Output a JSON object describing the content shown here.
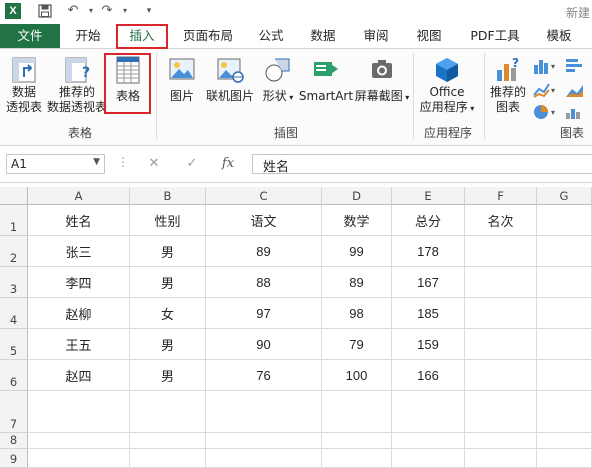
{
  "title_bar": {
    "app_icon": "X",
    "undo_icon": "↶",
    "redo_icon": "↷",
    "title_text": "新建"
  },
  "tabs": [
    "文件",
    "开始",
    "插入",
    "页面布局",
    "公式",
    "数据",
    "审阅",
    "视图",
    "PDF工具",
    "模板"
  ],
  "active_tab": "插入",
  "ribbon": {
    "btn_pivot": [
      "数据",
      "透视表"
    ],
    "btn_recommended_pivot": [
      "推荐的",
      "数据透视表"
    ],
    "btn_table": "表格",
    "group_tables": "表格",
    "btn_picture": "图片",
    "btn_online_picture": "联机图片",
    "btn_shapes": "形状",
    "btn_smartart": "SmartArt",
    "btn_screenshot": "屏幕截图",
    "group_illustrations": "插图",
    "btn_office_apps": [
      "Office",
      "应用程序"
    ],
    "group_apps": "应用程序",
    "btn_recommended_charts": [
      "推荐的",
      "图表"
    ],
    "group_charts": "图表"
  },
  "formula_bar": {
    "name_box": "A1",
    "fx": "fx",
    "formula": "姓名"
  },
  "columns": [
    "A",
    "B",
    "C",
    "D",
    "E",
    "F",
    "G"
  ],
  "rows": [
    "1",
    "2",
    "3",
    "4",
    "5",
    "6",
    "7",
    "8",
    "9"
  ],
  "cells": [
    [
      "姓名",
      "性别",
      "语文",
      "数学",
      "总分",
      "名次"
    ],
    [
      "张三",
      "男",
      "89",
      "99",
      "178",
      ""
    ],
    [
      "李四",
      "男",
      "88",
      "89",
      "167",
      ""
    ],
    [
      "赵柳",
      "女",
      "97",
      "98",
      "185",
      ""
    ],
    [
      "王五",
      "男",
      "90",
      "79",
      "159",
      ""
    ],
    [
      "赵四",
      "男",
      "76",
      "100",
      "166",
      ""
    ]
  ],
  "colors": {
    "excel_green": "#217346",
    "highlight_red": "#d9262c"
  }
}
